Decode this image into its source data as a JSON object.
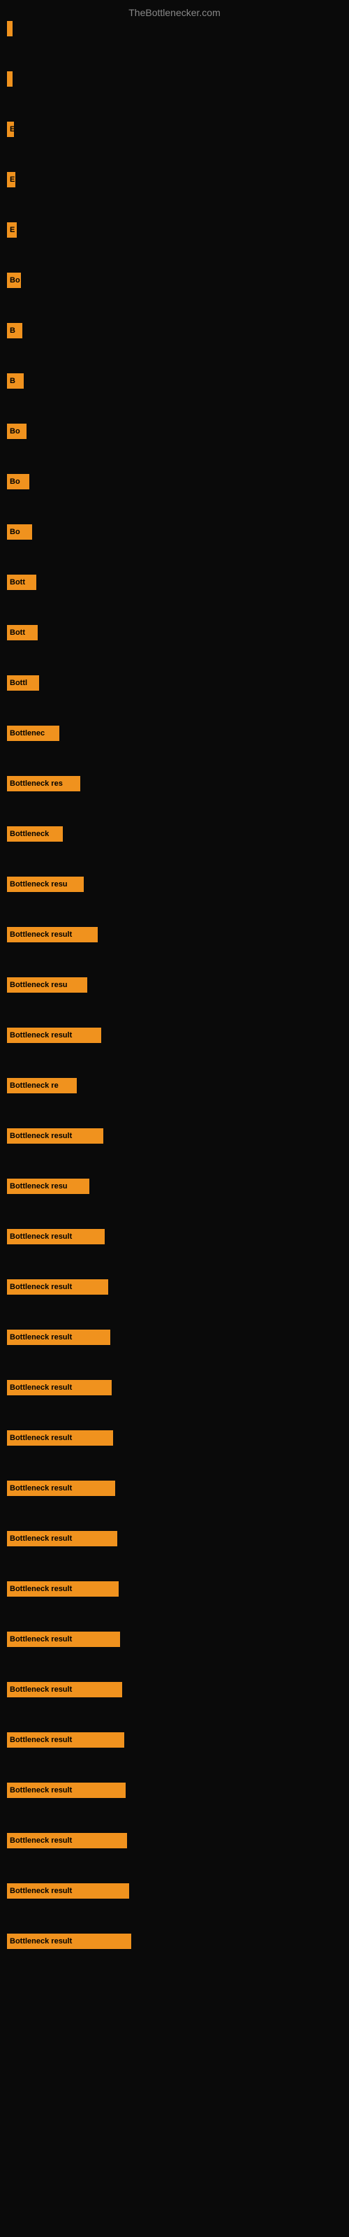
{
  "site": {
    "title": "TheBottlenecker.com"
  },
  "bars": [
    {
      "label": "",
      "width": 4
    },
    {
      "label": "",
      "width": 4
    },
    {
      "label": "E",
      "width": 10
    },
    {
      "label": "E",
      "width": 12
    },
    {
      "label": "E",
      "width": 14
    },
    {
      "label": "Bo",
      "width": 20
    },
    {
      "label": "B",
      "width": 22
    },
    {
      "label": "B",
      "width": 24
    },
    {
      "label": "Bo",
      "width": 28
    },
    {
      "label": "Bo",
      "width": 32
    },
    {
      "label": "Bo",
      "width": 36
    },
    {
      "label": "Bott",
      "width": 42
    },
    {
      "label": "Bott",
      "width": 44
    },
    {
      "label": "Bottl",
      "width": 46
    },
    {
      "label": "Bottlenec",
      "width": 75
    },
    {
      "label": "Bottleneck res",
      "width": 105
    },
    {
      "label": "Bottleneck",
      "width": 80
    },
    {
      "label": "Bottleneck resu",
      "width": 110
    },
    {
      "label": "Bottleneck result",
      "width": 130
    },
    {
      "label": "Bottleneck resu",
      "width": 115
    },
    {
      "label": "Bottleneck result",
      "width": 135
    },
    {
      "label": "Bottleneck re",
      "width": 100
    },
    {
      "label": "Bottleneck result",
      "width": 138
    },
    {
      "label": "Bottleneck resu",
      "width": 118
    },
    {
      "label": "Bottleneck result",
      "width": 140
    },
    {
      "label": "Bottleneck result",
      "width": 145
    },
    {
      "label": "Bottleneck result",
      "width": 148
    },
    {
      "label": "Bottleneck result",
      "width": 150
    },
    {
      "label": "Bottleneck result",
      "width": 152
    },
    {
      "label": "Bottleneck result",
      "width": 155
    },
    {
      "label": "Bottleneck result",
      "width": 158
    },
    {
      "label": "Bottleneck result",
      "width": 160
    },
    {
      "label": "Bottleneck result",
      "width": 162
    },
    {
      "label": "Bottleneck result",
      "width": 165
    },
    {
      "label": "Bottleneck result",
      "width": 168
    },
    {
      "label": "Bottleneck result",
      "width": 170
    },
    {
      "label": "Bottleneck result",
      "width": 172
    },
    {
      "label": "Bottleneck result",
      "width": 175
    },
    {
      "label": "Bottleneck result",
      "width": 178
    }
  ]
}
